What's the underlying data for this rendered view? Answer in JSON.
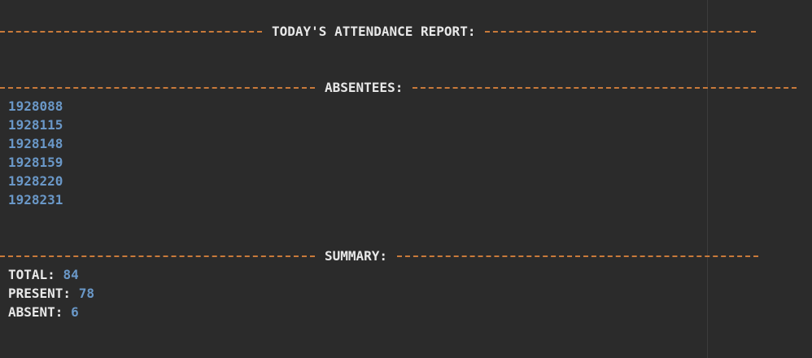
{
  "report": {
    "header_title": "TODAY'S ATTENDANCE REPORT:",
    "absentees_title": "ABSENTEES:",
    "summary_title": "SUMMARY:",
    "absentees": [
      "1928088",
      "1928115",
      "1928148",
      "1928159",
      "1928220",
      "1928231"
    ],
    "summary": {
      "total_label": "TOTAL:",
      "total_value": "84",
      "present_label": "PRESENT:",
      "present_value": "78",
      "absent_label": "ABSENT:",
      "absent_value": "6"
    }
  },
  "colors": {
    "background": "#2b2b2b",
    "dash": "#c97a3a",
    "number": "#6a98c8",
    "text": "#e8e8e8"
  }
}
